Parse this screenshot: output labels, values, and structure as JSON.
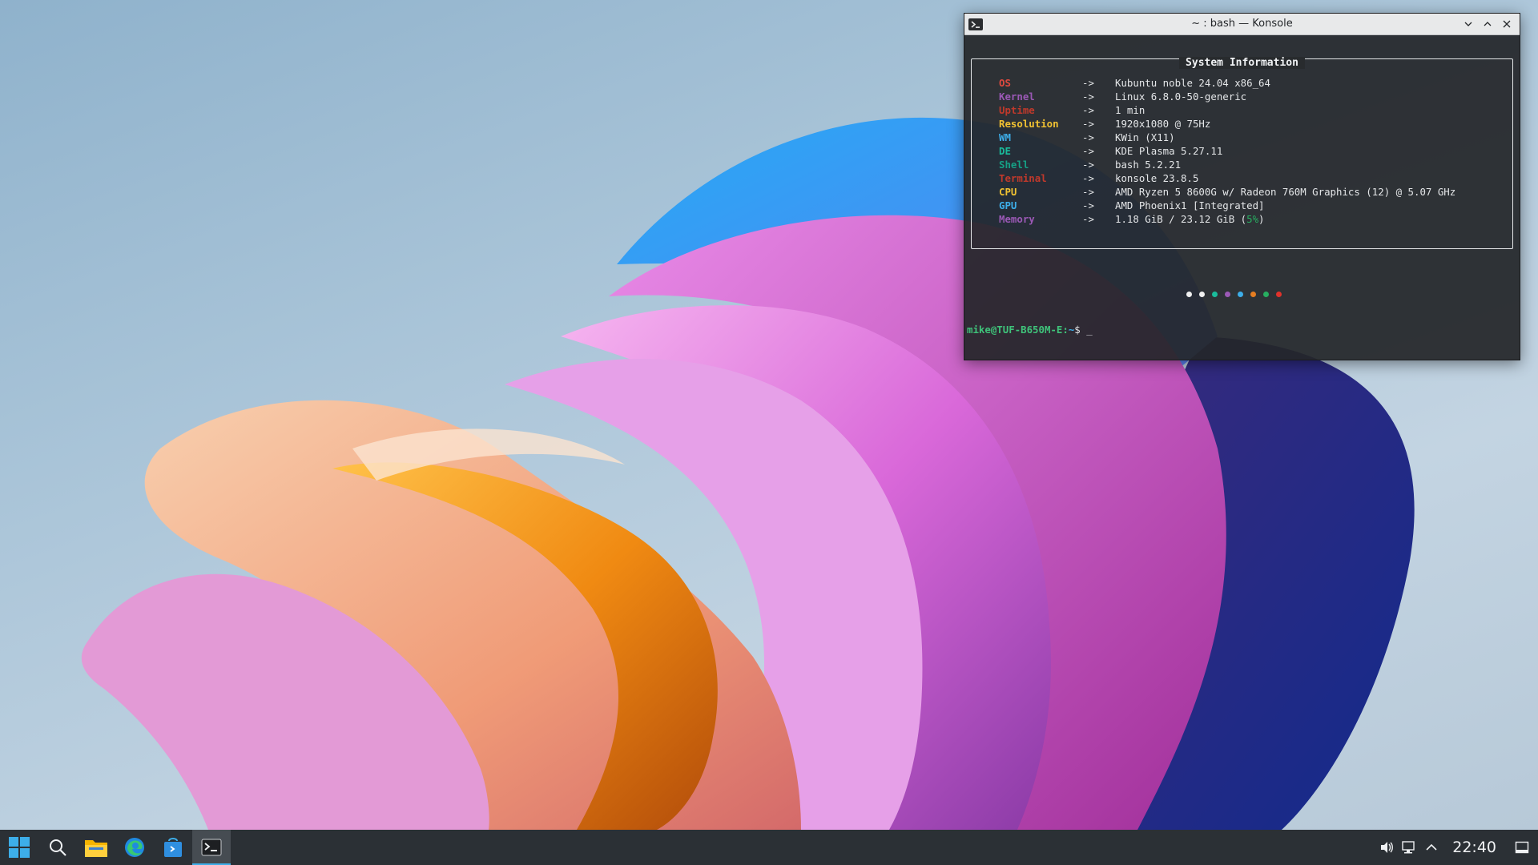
{
  "window": {
    "title": "~ : bash — Konsole",
    "app_icon": "terminal-icon",
    "controls": [
      "minimize-chevron-icon",
      "maximize-chevron-icon",
      "close-icon"
    ]
  },
  "terminal": {
    "box_title": "System Information",
    "arrow": "->",
    "rows": [
      {
        "key": "OS",
        "value": "Kubuntu noble 24.04 x86_64",
        "color": "#e04a3f"
      },
      {
        "key": "Kernel",
        "value": "Linux 6.8.0-50-generic",
        "color": "#9b59b6"
      },
      {
        "key": "Uptime",
        "value": "1 min",
        "color": "#c0392b"
      },
      {
        "key": "Resolution",
        "value": "1920x1080 @ 75Hz",
        "color": "#f1c232"
      },
      {
        "key": "WM",
        "value": "KWin (X11)",
        "color": "#3daee9"
      },
      {
        "key": "DE",
        "value": "KDE Plasma 5.27.11",
        "color": "#1abc9c"
      },
      {
        "key": "Shell",
        "value": "bash 5.2.21",
        "color": "#16a085"
      },
      {
        "key": "Terminal",
        "value": "konsole 23.8.5",
        "color": "#c0392b"
      },
      {
        "key": "CPU",
        "value": "AMD Ryzen 5 8600G w/ Radeon 760M Graphics (12) @ 5.07 GHz",
        "color": "#f1c232"
      },
      {
        "key": "GPU",
        "value": "AMD Phoenix1 [Integrated]",
        "color": "#3daee9"
      },
      {
        "key": "Memory",
        "value_main": "1.18 GiB / 23.12 GiB (",
        "value_pct": "5%",
        "value_end": ")",
        "color": "#9b59b6",
        "pct_color": "#27ae60"
      }
    ],
    "color_dots": [
      "#f0f0f0",
      "#f0f0f0",
      "#1abc9c",
      "#9b59b6",
      "#3daee9",
      "#e67e22",
      "#27ae60",
      "#e0322b"
    ],
    "prompt": "mike@TUF-B650M-E:",
    "prompt_path": "~",
    "prompt_suffix": "$ _"
  },
  "taskbar": {
    "items": [
      {
        "name": "start-menu-icon",
        "active": false
      },
      {
        "name": "search-icon",
        "active": false
      },
      {
        "name": "file-manager-icon",
        "active": false
      },
      {
        "name": "edge-browser-icon",
        "active": false
      },
      {
        "name": "discover-store-icon",
        "active": false
      },
      {
        "name": "konsole-task-icon",
        "active": true
      }
    ],
    "tray": [
      "volume-icon",
      "network-icon",
      "tray-expand-icon"
    ],
    "clock": "22:40",
    "show_desktop": "show-desktop-icon"
  },
  "colors": {
    "taskbar_bg": "#2b3035",
    "terminal_bg": "#232629",
    "accent": "#3daee9"
  }
}
